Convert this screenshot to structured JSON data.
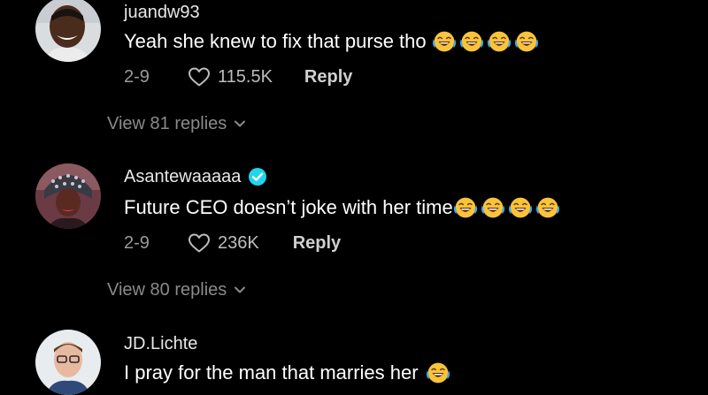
{
  "comments": [
    {
      "username": "juandw93",
      "verified": false,
      "text": "Yeah she knew to fix that purse tho",
      "emoji_icon": "face-with-tears-of-joy-icon",
      "emoji_count": 4,
      "date": "2-9",
      "likes": "115.5K",
      "reply_label": "Reply",
      "view_replies": "View 81 replies"
    },
    {
      "username": "Asantewaaaaa",
      "verified": true,
      "text": "Future CEO doesn’t joke with her time",
      "emoji_icon": "face-with-tears-of-joy-icon",
      "emoji_count": 4,
      "date": "2-9",
      "likes": "236K",
      "reply_label": "Reply",
      "view_replies": "View 80 replies"
    },
    {
      "username": "JD.Lichte",
      "verified": false,
      "text": "I pray for the man that marries her",
      "emoji_icon": "face-with-tears-of-joy-icon",
      "emoji_count": 1
    }
  ],
  "colors": {
    "background": "#000000",
    "primary_text": "#ffffff",
    "secondary_text": "#9a9a9a",
    "verified_badge": "#20d5ec"
  }
}
